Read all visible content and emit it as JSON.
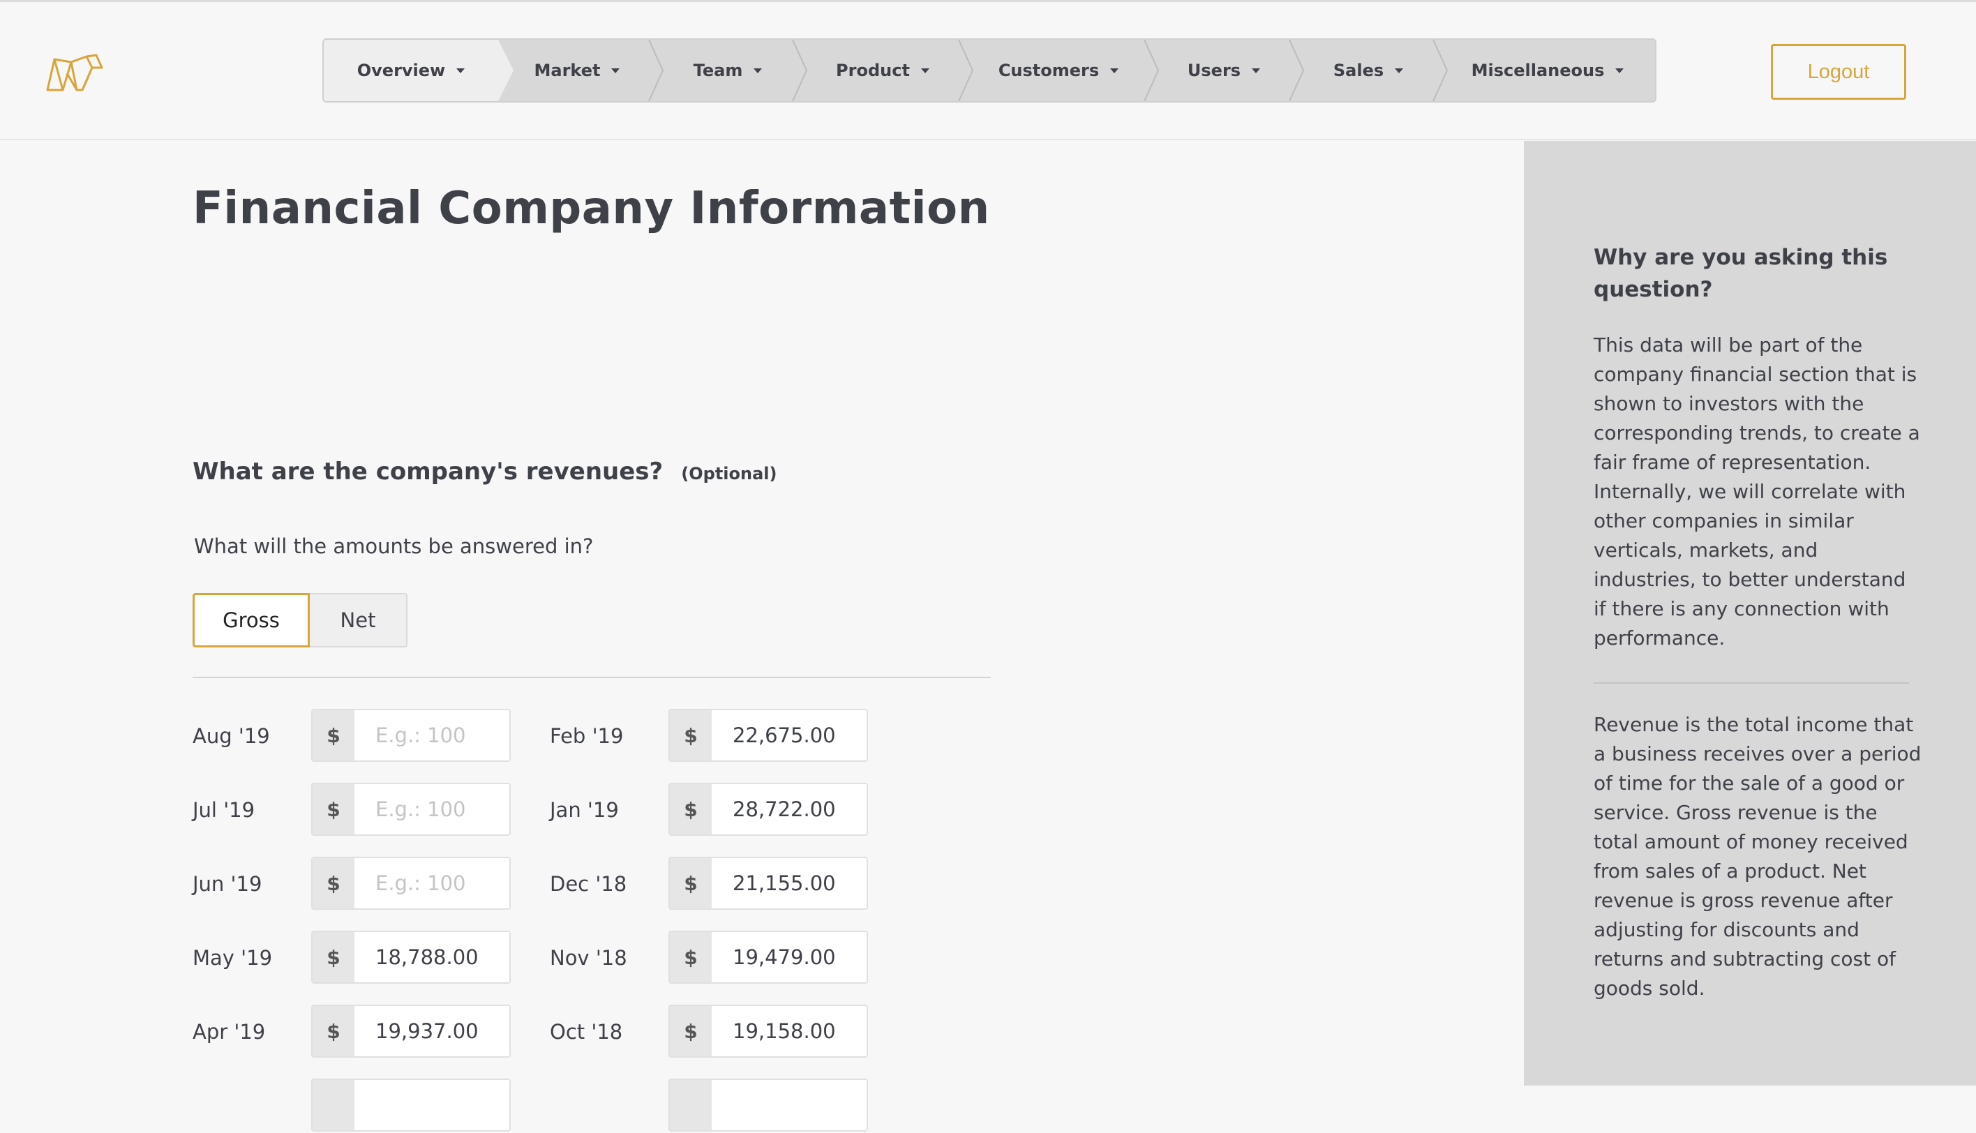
{
  "nav": {
    "items": [
      {
        "label": "Overview"
      },
      {
        "label": "Market"
      },
      {
        "label": "Team"
      },
      {
        "label": "Product"
      },
      {
        "label": "Customers"
      },
      {
        "label": "Users"
      },
      {
        "label": "Sales"
      },
      {
        "label": "Miscellaneous"
      }
    ],
    "active": "Overview",
    "logout_label": "Logout"
  },
  "page": {
    "title": "Financial Company Information"
  },
  "question": {
    "title": "What are the company's revenues?",
    "optional": "(Optional)",
    "sub": "What will the amounts be answered in?",
    "toggle": {
      "gross": "Gross",
      "net": "Net",
      "selected": "Gross"
    },
    "currency_symbol": "$",
    "placeholder": "E.g.: 100",
    "left_column": [
      {
        "month": "Aug '19",
        "value": ""
      },
      {
        "month": "Jul '19",
        "value": ""
      },
      {
        "month": "Jun '19",
        "value": ""
      },
      {
        "month": "May '19",
        "value": "18,788.00"
      },
      {
        "month": "Apr '19",
        "value": "19,937.00"
      }
    ],
    "right_column": [
      {
        "month": "Feb '19",
        "value": "22,675.00"
      },
      {
        "month": "Jan '19",
        "value": "28,722.00"
      },
      {
        "month": "Dec '18",
        "value": "21,155.00"
      },
      {
        "month": "Nov '18",
        "value": "19,479.00"
      },
      {
        "month": "Oct '18",
        "value": "19,158.00"
      }
    ]
  },
  "sidebar": {
    "question": "Why are you asking this question?",
    "paragraph1": "This data will be part of the company financial section that is shown to investors with the corresponding trends, to create a fair frame of representation. Internally, we will correlate with other companies in similar verticals, markets, and industries, to better understand if there is any connection with performance.",
    "paragraph2": "Revenue is the total income that a business receives over a period of time for the sale of a good or service. Gross revenue is the total amount of money received from sales of a product. Net revenue is gross revenue after adjusting for discounts and returns and subtracting cost of goods sold."
  },
  "colors": {
    "accent": "#d9a53a",
    "text": "#3f4149",
    "nav_bg": "#d8d8d8",
    "sidebar_bg": "#d8d8d8"
  }
}
